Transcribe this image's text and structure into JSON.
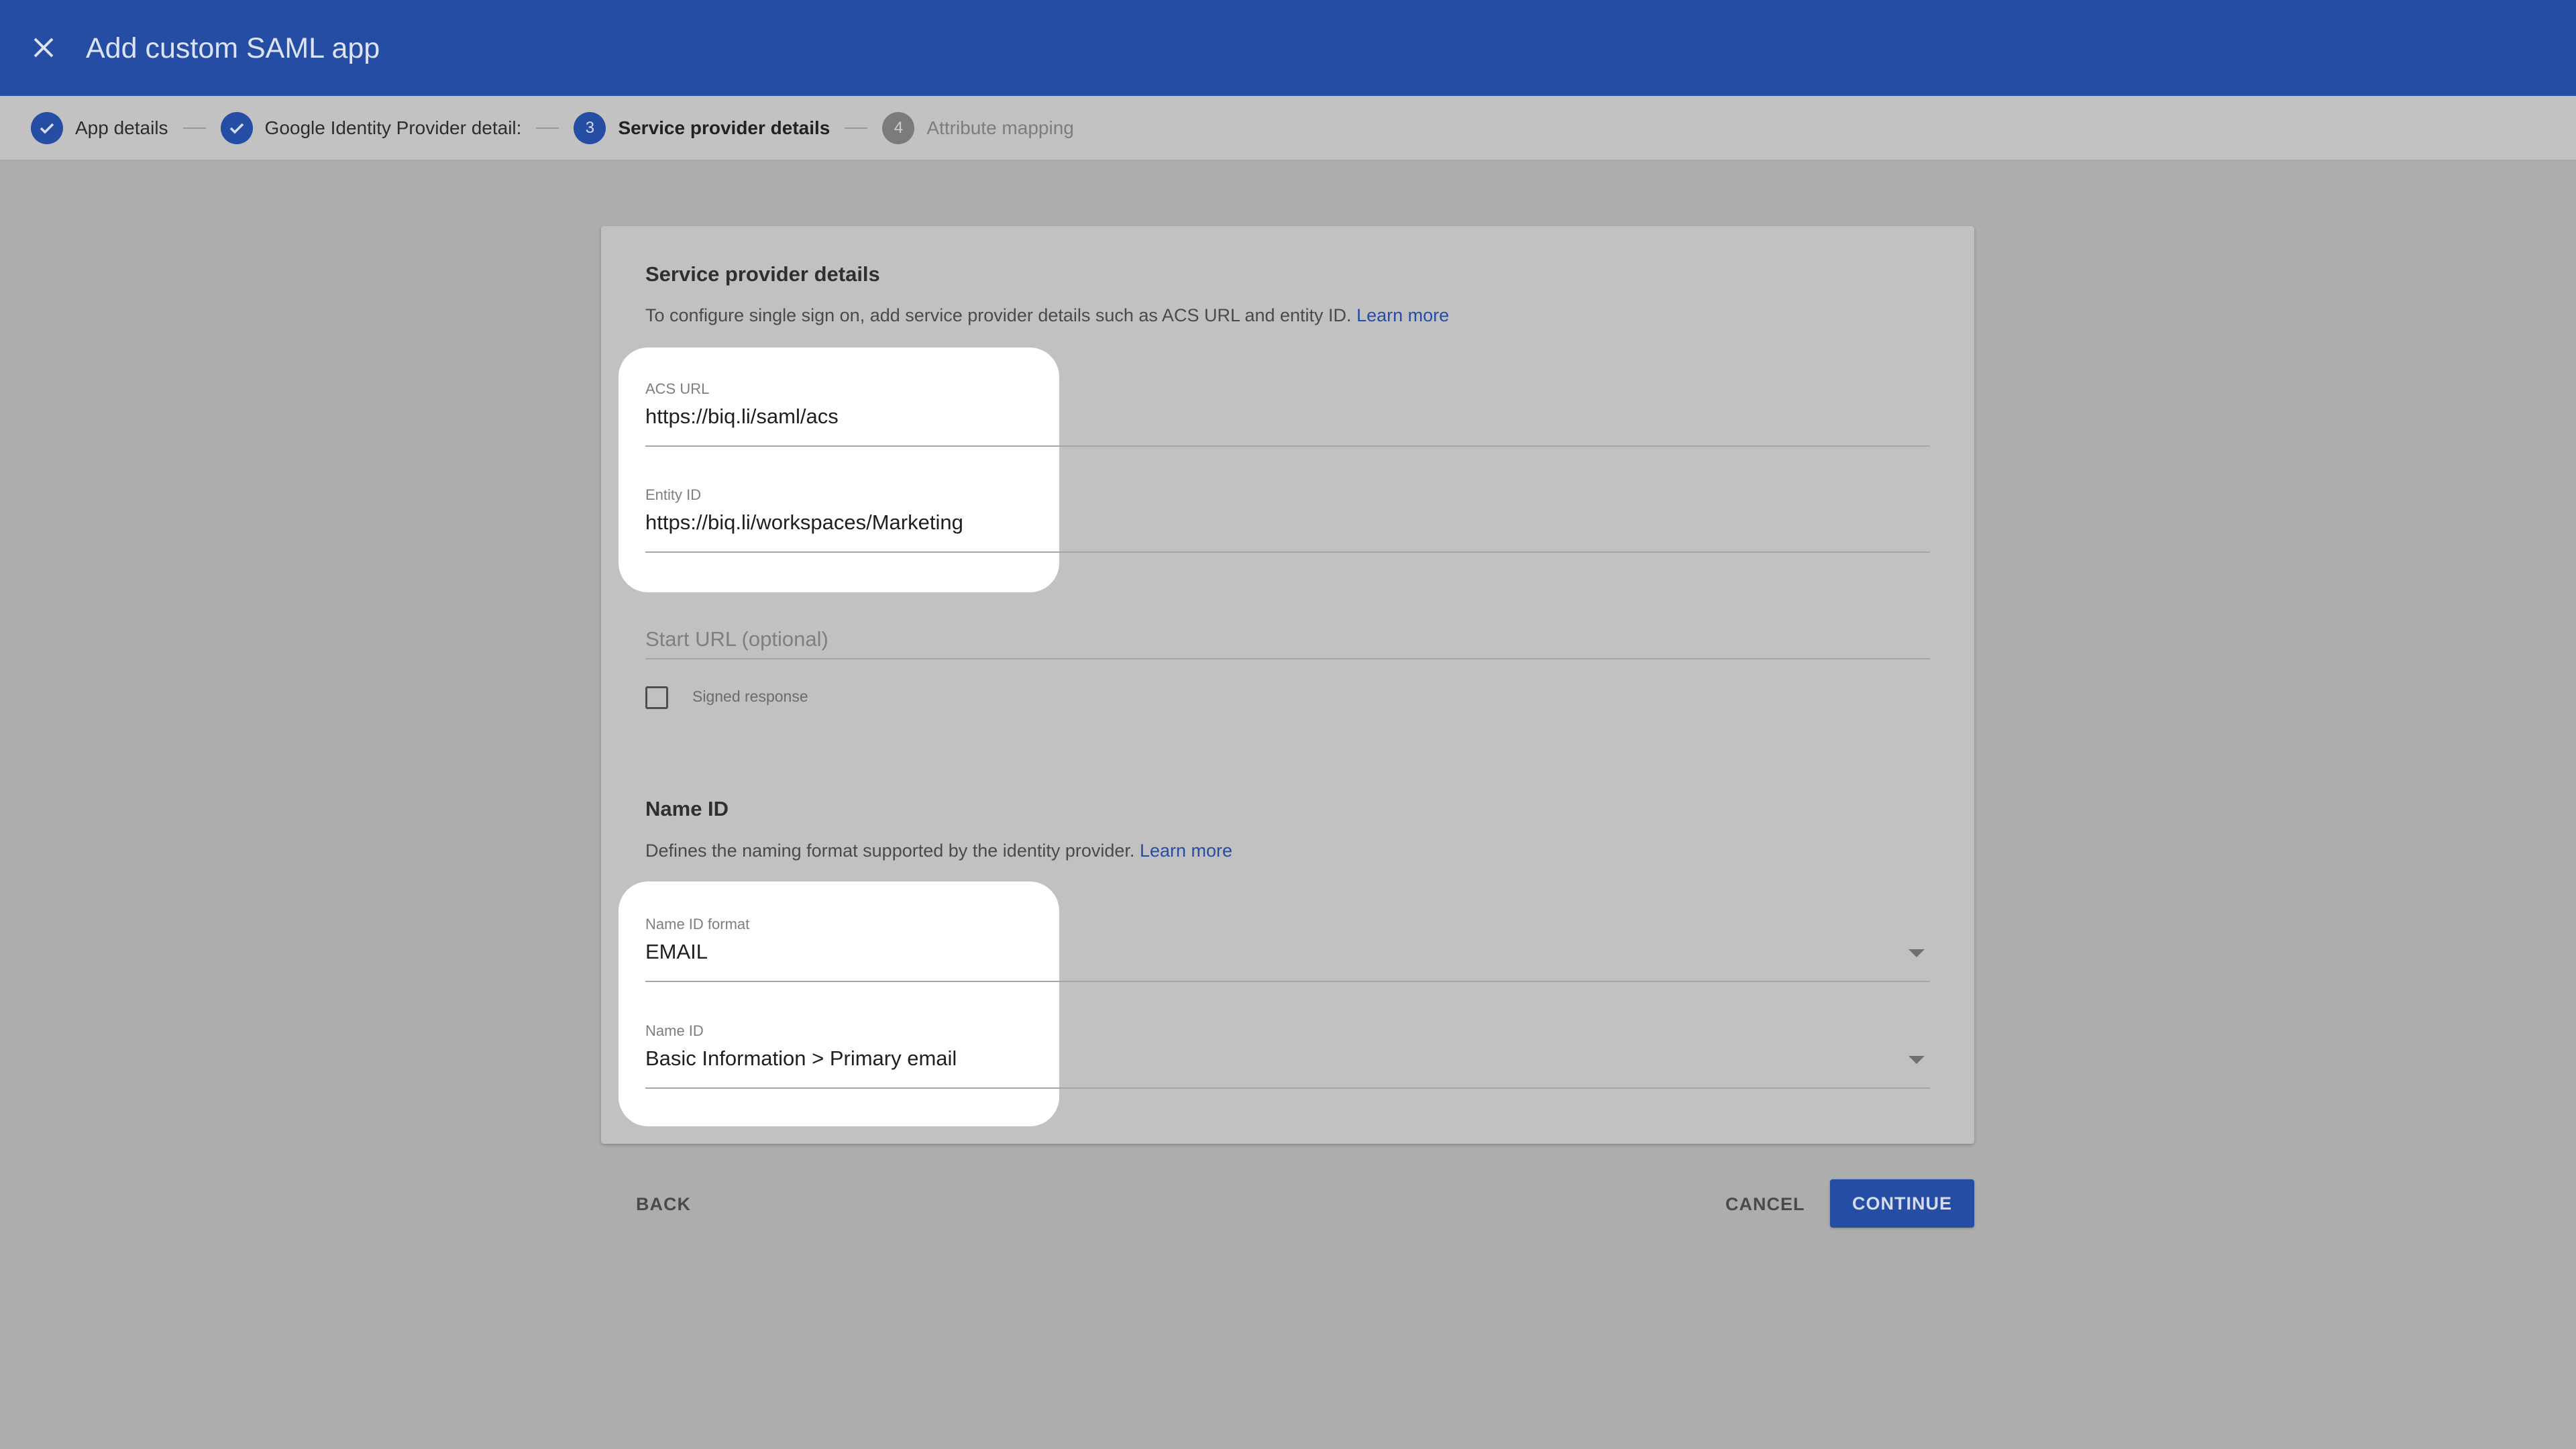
{
  "header": {
    "title": "Add custom SAML app",
    "close_icon": "close-icon"
  },
  "stepper": {
    "steps": [
      {
        "label": "App details",
        "state": "done",
        "icon": "check-icon"
      },
      {
        "label": "Google Identity Provider detail:",
        "state": "done",
        "icon": "check-icon"
      },
      {
        "label": "Service provider details",
        "state": "active",
        "number": "3"
      },
      {
        "label": "Attribute mapping",
        "state": "pending",
        "number": "4"
      }
    ]
  },
  "service_provider": {
    "title": "Service provider details",
    "description": "To configure single sign on, add service provider details such as ACS URL and entity ID.",
    "learn_more": "Learn more",
    "acs_url": {
      "label": "ACS URL",
      "value": "https://biq.li/saml/acs"
    },
    "entity_id": {
      "label": "Entity ID",
      "value": "https://biq.li/workspaces/Marketing"
    },
    "start_url": {
      "placeholder": "Start URL (optional)"
    },
    "signed_response": {
      "label": "Signed response",
      "checked": false
    }
  },
  "name_id": {
    "title": "Name ID",
    "description": "Defines the naming format supported by the identity provider.",
    "learn_more": "Learn more",
    "format": {
      "label": "Name ID format",
      "value": "EMAIL"
    },
    "name_id_field": {
      "label": "Name ID",
      "value": "Basic Information > Primary email"
    }
  },
  "actions": {
    "back": "BACK",
    "cancel": "CANCEL",
    "continue": "CONTINUE"
  },
  "colors": {
    "brand": "#244da3",
    "background": "#adadad",
    "card": "#c1c1c1",
    "highlight": "#ffffff"
  }
}
